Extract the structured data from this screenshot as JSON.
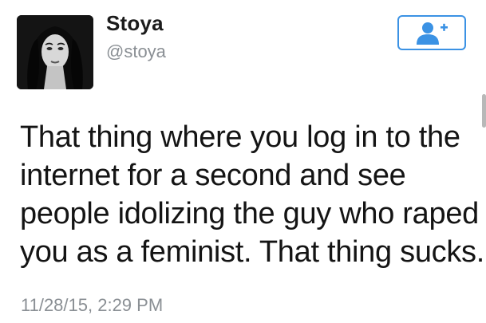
{
  "tweet": {
    "display_name": "Stoya",
    "handle": "@stoya",
    "text_lines": [
      "That thing where you log in to the",
      "internet for a second and see",
      "people idolizing the guy who raped",
      "you as a feminist. That thing sucks."
    ],
    "timestamp": "11/28/15, 2:29 PM"
  },
  "icons": {
    "follow": "add-user-icon",
    "avatar": "profile-photo"
  },
  "colors": {
    "accent": "#3b92e4",
    "muted_text": "#8a8f94",
    "body_text": "#141414"
  }
}
